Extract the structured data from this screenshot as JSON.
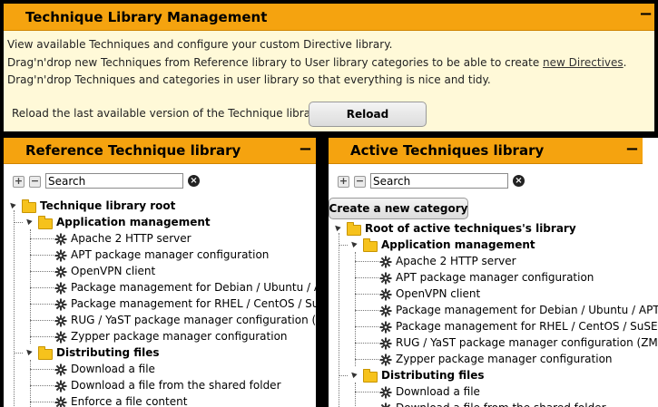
{
  "header": {
    "title": "Technique Library Management",
    "collapse": "−"
  },
  "description": {
    "line1": "View available Techniques and configure your custom Directive library.",
    "line2_pre": "Drag'n'drop new Techniques from Reference library to User library categories to be able to create ",
    "line2_link": "new Directives",
    "line2_post": ".",
    "line3": "Drag'n'drop Techniques and categories in user library so that everything is nice and tidy."
  },
  "reload": {
    "label": "Reload the last available version of the Technique library",
    "button": "Reload"
  },
  "reference": {
    "title": "Reference Technique library",
    "collapse": "−",
    "search_value": "Search",
    "root": "Technique library root",
    "categories": [
      {
        "name": "Application management",
        "items": [
          "Apache 2 HTTP server",
          "APT package manager configuration",
          "OpenVPN client",
          "Package management for Debian / Ubuntu / APT systems",
          "Package management for RHEL / CentOS / SuSE / RPM systems",
          "RUG / YaST package manager configuration (ZMD)",
          "Zypper package manager configuration"
        ]
      },
      {
        "name": "Distributing files",
        "items": [
          "Download a file",
          "Download a file from the shared folder",
          "Enforce a file content"
        ]
      }
    ]
  },
  "active": {
    "title": "Active Techniques library",
    "collapse": "−",
    "search_value": "Search",
    "new_category": "Create a new category",
    "root": "Root of active techniques's library",
    "categories": [
      {
        "name": "Application management",
        "items": [
          "Apache 2 HTTP server",
          "APT package manager configuration",
          "OpenVPN client",
          "Package management for Debian / Ubuntu / APT systems",
          "Package management for RHEL / CentOS / SuSE / RPM systems",
          "RUG / YaST package manager configuration (ZMD)",
          "Zypper package manager configuration"
        ]
      },
      {
        "name": "Distributing files",
        "items": [
          "Download a file",
          "Download a file from the shared folder"
        ]
      }
    ]
  }
}
